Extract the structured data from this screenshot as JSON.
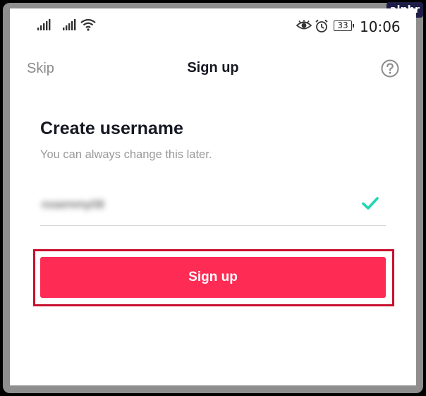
{
  "watermark": "alphr",
  "status_bar": {
    "battery": "33",
    "time": "10:06",
    "icons": [
      "signal-icon",
      "signal-icon",
      "wifi-icon",
      "eye-icon",
      "alarm-icon",
      "battery-icon"
    ]
  },
  "header": {
    "skip_label": "Skip",
    "title": "Sign up",
    "help_icon": "question-circle-icon"
  },
  "form": {
    "heading": "Create username",
    "subheading": "You can always change this later.",
    "username_value": "rosemmy08",
    "valid_icon": "checkmark-icon",
    "submit_label": "Sign up"
  },
  "colors": {
    "accent": "#fe2c55",
    "highlight": "#c8102e",
    "check": "#20d5b4",
    "watermark_bg": "#1d1d47"
  }
}
